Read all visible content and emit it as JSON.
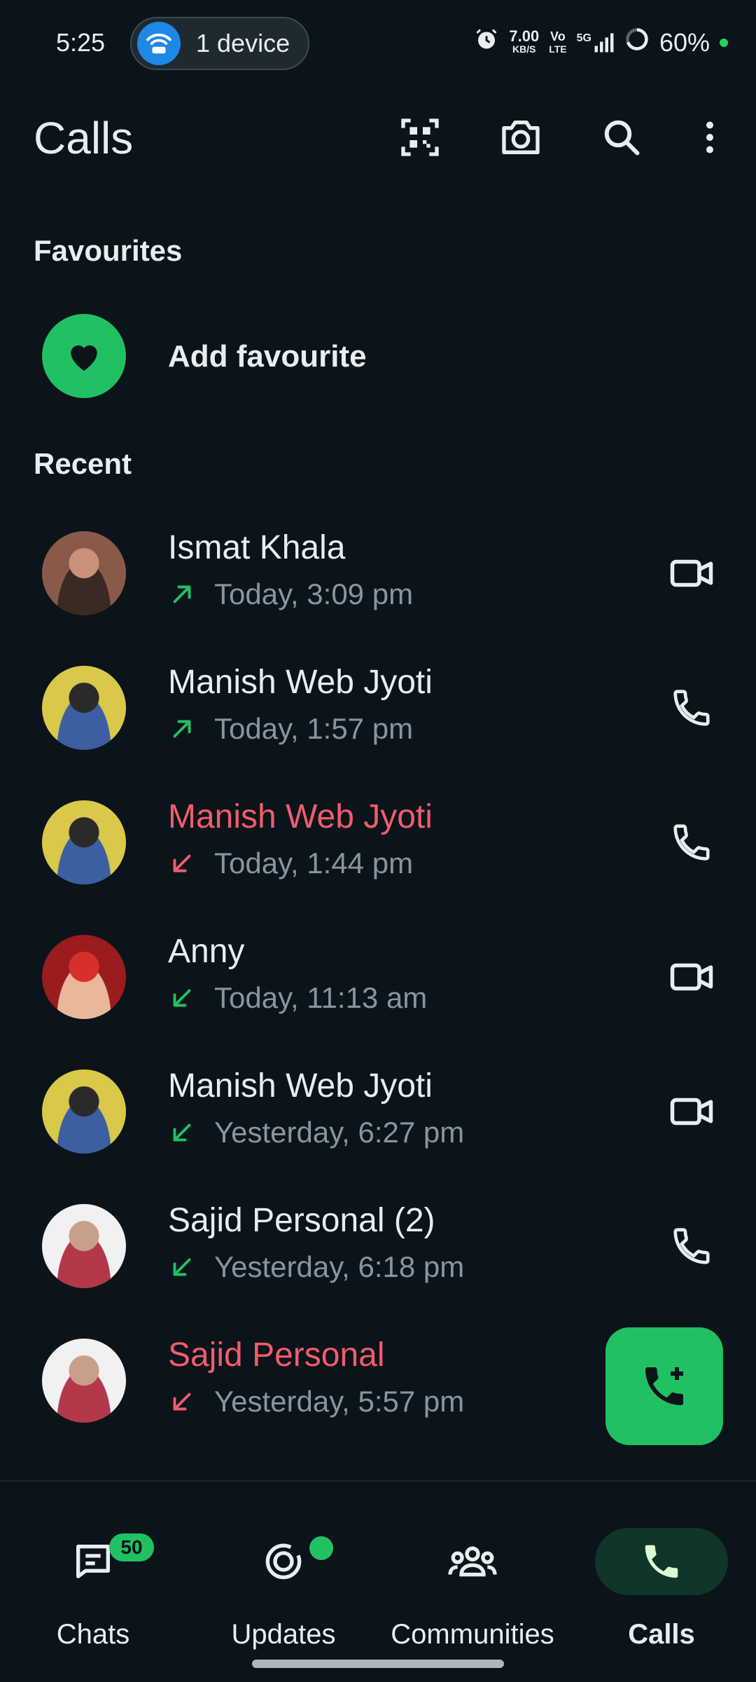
{
  "status_bar": {
    "time": "5:25",
    "hotspot_label": "1 device",
    "net_speed_top": "7.00",
    "net_speed_bottom": "KB/S",
    "volte_top": "Vo",
    "volte_bottom": "LTE",
    "network": "5G",
    "battery": "60%"
  },
  "header": {
    "title": "Calls"
  },
  "favourites": {
    "section_title": "Favourites",
    "add_label": "Add favourite"
  },
  "recent": {
    "section_title": "Recent",
    "calls": [
      {
        "name": "Ismat Khala",
        "time": "Today, 3:09 pm",
        "direction": "outgoing",
        "missed": false,
        "type": "video"
      },
      {
        "name": "Manish Web Jyoti",
        "time": "Today, 1:57 pm",
        "direction": "outgoing",
        "missed": false,
        "type": "voice"
      },
      {
        "name": "Manish Web Jyoti",
        "time": "Today, 1:44 pm",
        "direction": "incoming",
        "missed": true,
        "type": "voice"
      },
      {
        "name": "Anny",
        "time": "Today, 11:13 am",
        "direction": "incoming",
        "missed": false,
        "type": "video"
      },
      {
        "name": "Manish Web Jyoti",
        "time": "Yesterday, 6:27 pm",
        "direction": "incoming",
        "missed": false,
        "type": "video"
      },
      {
        "name": "Sajid Personal (2)",
        "time": "Yesterday, 6:18 pm",
        "direction": "incoming",
        "missed": false,
        "type": "voice"
      },
      {
        "name": "Sajid Personal",
        "time": "Yesterday, 5:57 pm",
        "direction": "incoming",
        "missed": true,
        "type": "voice"
      }
    ]
  },
  "bottom_nav": {
    "items": [
      {
        "label": "Chats",
        "badge": "50"
      },
      {
        "label": "Updates"
      },
      {
        "label": "Communities"
      },
      {
        "label": "Calls"
      }
    ]
  },
  "colors": {
    "accent": "#21c063",
    "missed": "#f15c6d",
    "background": "#0b141a",
    "muted": "#8696a0"
  }
}
